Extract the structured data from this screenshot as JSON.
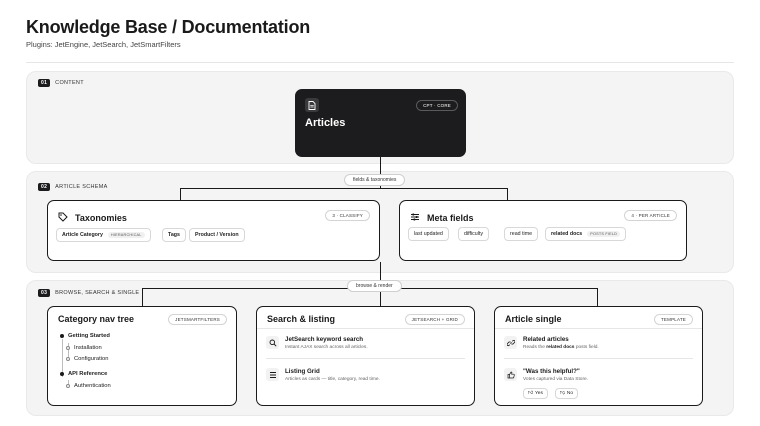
{
  "header": {
    "title": "Knowledge Base / Documentation",
    "subtitle": "Plugins: JetEngine, JetSearch, JetSmartFilters"
  },
  "sections": [
    {
      "num": "01",
      "label": "CONTENT"
    },
    {
      "num": "02",
      "label": "ARTICLE SCHEMA"
    },
    {
      "num": "03",
      "label": "BROWSE, SEARCH & SINGLE"
    }
  ],
  "articles": {
    "title": "Articles",
    "badge": "CPT · CORE",
    "icon": "document-icon"
  },
  "edges": {
    "fields": "fields & taxonomies",
    "browse": "browse & render"
  },
  "taxonomies": {
    "title": "Taxonomies",
    "badge": "3 · CLASSIFY",
    "icon": "tag-icon",
    "chips": [
      {
        "label": "Article Category",
        "tag": "HIERARCHICAL"
      },
      {
        "label": "Tags"
      },
      {
        "label": "Product / Version"
      }
    ]
  },
  "meta": {
    "title": "Meta fields",
    "badge": "4 · PER ARTICLE",
    "icon": "sliders-icon",
    "chips": [
      {
        "label": "last updated"
      },
      {
        "label": "difficulty"
      },
      {
        "label": "read time"
      },
      {
        "label": "related docs",
        "tag": "POSTS FIELD"
      }
    ]
  },
  "nav": {
    "title": "Category nav tree",
    "badge": "JETSMARTFILTERS",
    "items": [
      {
        "label": "Getting Started",
        "children": [
          "Installation",
          "Configuration"
        ]
      },
      {
        "label": "API Reference",
        "children": [
          "Authentication"
        ]
      }
    ]
  },
  "search": {
    "title": "Search & listing",
    "badge": "JETSEARCH + GRID",
    "features": [
      {
        "icon": "search-icon",
        "title": "JetSearch keyword search",
        "desc": "Instant AJAX search across all articles."
      },
      {
        "icon": "list-icon",
        "title": "Listing Grid",
        "desc": "Articles as cards — title, category, read time."
      }
    ]
  },
  "single": {
    "title": "Article single",
    "badge": "TEMPLATE",
    "related": {
      "icon": "link-icon",
      "title": "Related articles",
      "desc_pre": "Reads the",
      "desc_hl": "related docs",
      "desc_post": "posts field."
    },
    "helpful": {
      "icon": "thumbs-up-icon",
      "title": "\"Was this helpful?\"",
      "desc": "Votes captured via Data Store.",
      "yes": "Yes",
      "no": "No"
    }
  },
  "colors": {
    "dark": "#1c1c1e",
    "band": "#f4f4f4",
    "border": "#1a1a1a"
  }
}
